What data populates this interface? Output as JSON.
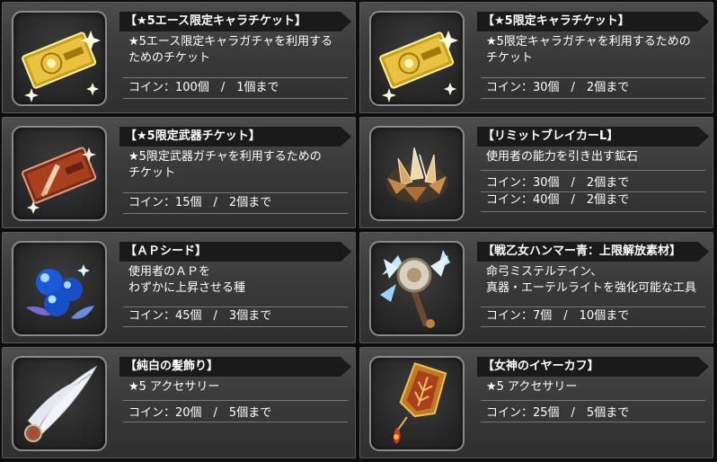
{
  "items": [
    {
      "title": "【★5エース限定キャラチケット】",
      "desc_lines": [
        "★5エース限定キャラガチャを利用する",
        "ためのチケット"
      ],
      "costs": [
        "コイン：100個　/　1個まで"
      ],
      "icon": "gold-ticket-icon"
    },
    {
      "title": "【★5限定キャラチケット】",
      "desc_lines": [
        "★5限定キャラガチャを利用するための",
        "チケット"
      ],
      "costs": [
        "コイン：30個　/　2個まで"
      ],
      "icon": "gold-ticket-icon"
    },
    {
      "title": "【★5限定武器チケット】",
      "desc_lines": [
        "★5限定武器ガチャを利用するための",
        "チケット"
      ],
      "costs": [
        "コイン：15個　/　2個まで"
      ],
      "icon": "red-weapon-ticket-icon"
    },
    {
      "title": "【リミットブレイカーL】",
      "desc_lines": [
        "使用者の能力を引き出す鉱石"
      ],
      "costs": [
        "コイン：30個　/　2個まで",
        "コイン：40個　/　2個まで"
      ],
      "icon": "crystal-ore-icon"
    },
    {
      "title": "【ＡＰシード】",
      "desc_lines": [
        "使用者のＡＰを",
        "わずかに上昇させる種"
      ],
      "costs": [
        "コイン：45個　/　3個まで"
      ],
      "icon": "blue-seed-icon"
    },
    {
      "title": "【戦乙女ハンマー青：上限解放素材】",
      "desc_lines": [
        "命弓ミステルテイン、",
        "真器・エーテルライトを強化可能な工具"
      ],
      "costs": [
        "コイン：7個　/　10個まで"
      ],
      "icon": "ice-hammer-icon"
    },
    {
      "title": "【純白の髪飾り】",
      "desc_lines": [
        "★5 アクセサリー"
      ],
      "costs": [
        "コイン：20個　/　5個まで"
      ],
      "icon": "white-feather-icon"
    },
    {
      "title": "【女神のイヤーカフ】",
      "desc_lines": [
        "★5 アクセサリー"
      ],
      "costs": [
        "コイン：25個　/　5個まで"
      ],
      "icon": "earcuff-icon"
    }
  ],
  "colors": {
    "card_bg": "#3c3c3c",
    "title_bar": "#1a1a1a",
    "separator": "#777777",
    "text": "#ffffff"
  }
}
